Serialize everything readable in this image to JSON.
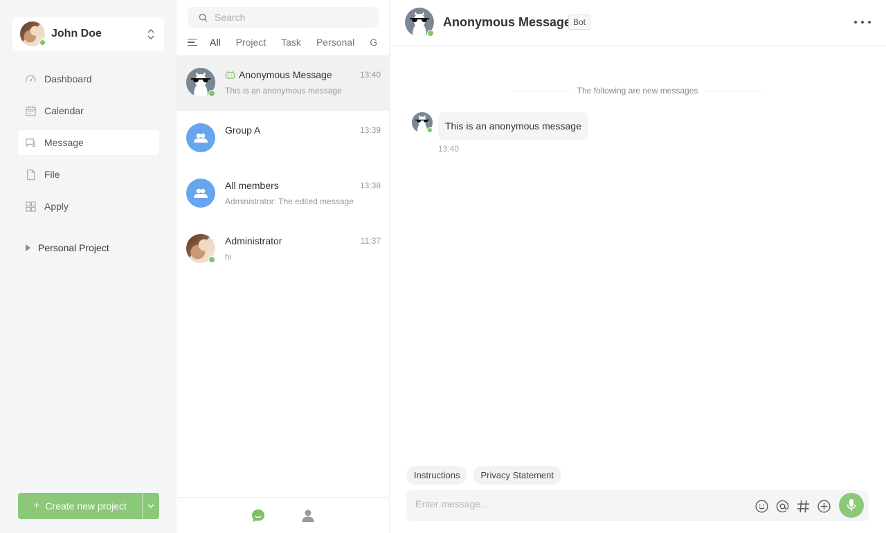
{
  "user": {
    "name": "John Doe",
    "status": "online"
  },
  "nav": {
    "items": [
      {
        "label": "Dashboard",
        "icon": "dashboard-icon"
      },
      {
        "label": "Calendar",
        "icon": "calendar-icon"
      },
      {
        "label": "Message",
        "icon": "message-icon",
        "active": true
      },
      {
        "label": "File",
        "icon": "file-icon"
      },
      {
        "label": "Apply",
        "icon": "apps-icon"
      }
    ],
    "project_section": "Personal Project",
    "create_button": "Create new project"
  },
  "list": {
    "search_placeholder": "Search",
    "tabs": [
      "All",
      "Project",
      "Task",
      "Personal",
      "G"
    ],
    "active_tab": "All",
    "conversations": [
      {
        "title": "Anonymous Message",
        "time": "13:40",
        "preview": "This is an anonymous message",
        "bot": true,
        "active": true
      },
      {
        "title": "Group A",
        "time": "13:39",
        "preview": ""
      },
      {
        "title": "All members",
        "time": "13:38",
        "preview": "Administrator: The edited message"
      },
      {
        "title": "Administrator",
        "time": "11:37",
        "preview": "hi"
      }
    ]
  },
  "chat": {
    "title": "Anonymous Message",
    "badge": "Bot",
    "divider": "The following are new messages",
    "messages": [
      {
        "text": "This is an anonymous message",
        "time": "13:40"
      }
    ],
    "quick_actions": [
      "Instructions",
      "Privacy Statement"
    ],
    "input_placeholder": "Enter message..."
  },
  "colors": {
    "accent": "#8bc878",
    "online": "#84c56a",
    "group": "#68a5ef",
    "sidebar_bg": "#f4f5f7"
  }
}
